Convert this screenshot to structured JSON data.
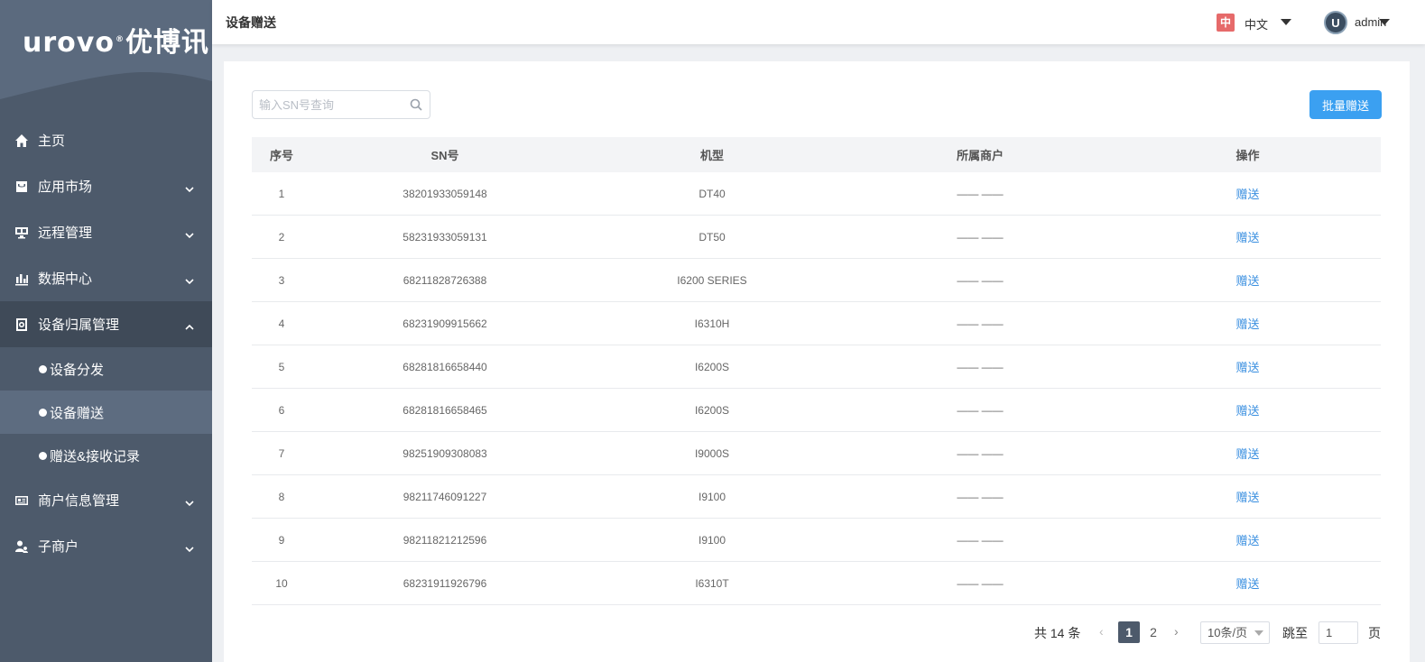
{
  "brand": {
    "logo_latin": "urovo",
    "logo_cn": "优博讯"
  },
  "header": {
    "page_title": "设备赠送",
    "lang_badge": "中",
    "lang_label": "中文",
    "user_name": "admin",
    "avatar_letter": "U"
  },
  "sidebar": {
    "items": [
      {
        "label": "主页",
        "icon": "home-icon"
      },
      {
        "label": "应用市场",
        "icon": "store-icon"
      },
      {
        "label": "远程管理",
        "icon": "remote-icon"
      },
      {
        "label": "数据中心",
        "icon": "chart-icon"
      },
      {
        "label": "设备归属管理",
        "icon": "device-icon"
      },
      {
        "label": "商户信息管理",
        "icon": "id-card-icon"
      },
      {
        "label": "子商户",
        "icon": "user-group-icon"
      }
    ],
    "sub_items": [
      {
        "label": "设备分发"
      },
      {
        "label": "设备赠送"
      },
      {
        "label": "赠送&接收记录"
      }
    ]
  },
  "toolbar": {
    "search_placeholder": "输入SN号查询",
    "batch_label": "批量赠送"
  },
  "table": {
    "headers": [
      "序号",
      "SN号",
      "机型",
      "所属商户",
      "操作"
    ],
    "rows": [
      {
        "no": "1",
        "sn": "38201933059148",
        "model": "DT40",
        "merchant": "—— ——",
        "action": "赠送"
      },
      {
        "no": "2",
        "sn": "58231933059131",
        "model": "DT50",
        "merchant": "—— ——",
        "action": "赠送"
      },
      {
        "no": "3",
        "sn": "68211828726388",
        "model": "I6200 SERIES",
        "merchant": "—— ——",
        "action": "赠送"
      },
      {
        "no": "4",
        "sn": "68231909915662",
        "model": "I6310H",
        "merchant": "—— ——",
        "action": "赠送"
      },
      {
        "no": "5",
        "sn": "68281816658440",
        "model": "I6200S",
        "merchant": "—— ——",
        "action": "赠送"
      },
      {
        "no": "6",
        "sn": "68281816658465",
        "model": "I6200S",
        "merchant": "—— ——",
        "action": "赠送"
      },
      {
        "no": "7",
        "sn": "98251909308083",
        "model": "I9000S",
        "merchant": "—— ——",
        "action": "赠送"
      },
      {
        "no": "8",
        "sn": "98211746091227",
        "model": "I9100",
        "merchant": "—— ——",
        "action": "赠送"
      },
      {
        "no": "9",
        "sn": "98211821212596",
        "model": "I9100",
        "merchant": "—— ——",
        "action": "赠送"
      },
      {
        "no": "10",
        "sn": "68231911926796",
        "model": "I6310T",
        "merchant": "—— ——",
        "action": "赠送"
      }
    ]
  },
  "pagination": {
    "total": "共 14 条",
    "pages": [
      "1",
      "2"
    ],
    "page_size": "10条/页",
    "goto_label": "跳至",
    "goto_value": "1",
    "unit": "页"
  },
  "colors": {
    "accent": "#3ba0f1",
    "sidebar": "#4d5a6b",
    "link": "#3a8fe0"
  }
}
